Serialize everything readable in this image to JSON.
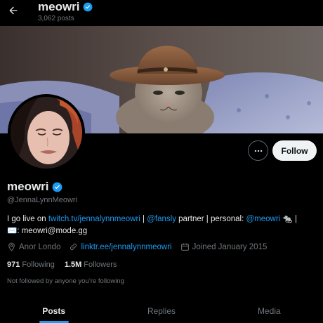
{
  "header": {
    "name": "meowri",
    "posts": "3,062 posts"
  },
  "profile": {
    "display_name": "meowri",
    "handle": "@JennaLynnMeowri",
    "follow_label": "Follow",
    "more_label": "More"
  },
  "bio": {
    "p1": "I go live on ",
    "link1": "twitch.tv/jennalynnmeowri",
    "p2": " | ",
    "link2": "@fansly",
    "p3": " partner | personal: ",
    "link3": "@meowri",
    "p4": " 🐀 | ",
    "p5": "✉️: meowri@mode.gg"
  },
  "meta": {
    "location": "Anor Londo",
    "website": "linktr.ee/jennalynnmeowri",
    "joined": "Joined January 2015"
  },
  "stats": {
    "following_count": "971",
    "following_label": "Following",
    "followers_count": "1.5M",
    "followers_label": "Followers"
  },
  "not_followed": "Not followed by anyone you’re following",
  "tabs": [
    {
      "label": "Posts",
      "active": true
    },
    {
      "label": "Replies",
      "active": false
    },
    {
      "label": "Media",
      "active": false
    }
  ],
  "colors": {
    "accent": "#1d9bf0",
    "background": "#000000",
    "text_primary": "#e7e9ea",
    "text_secondary": "#71767b"
  }
}
